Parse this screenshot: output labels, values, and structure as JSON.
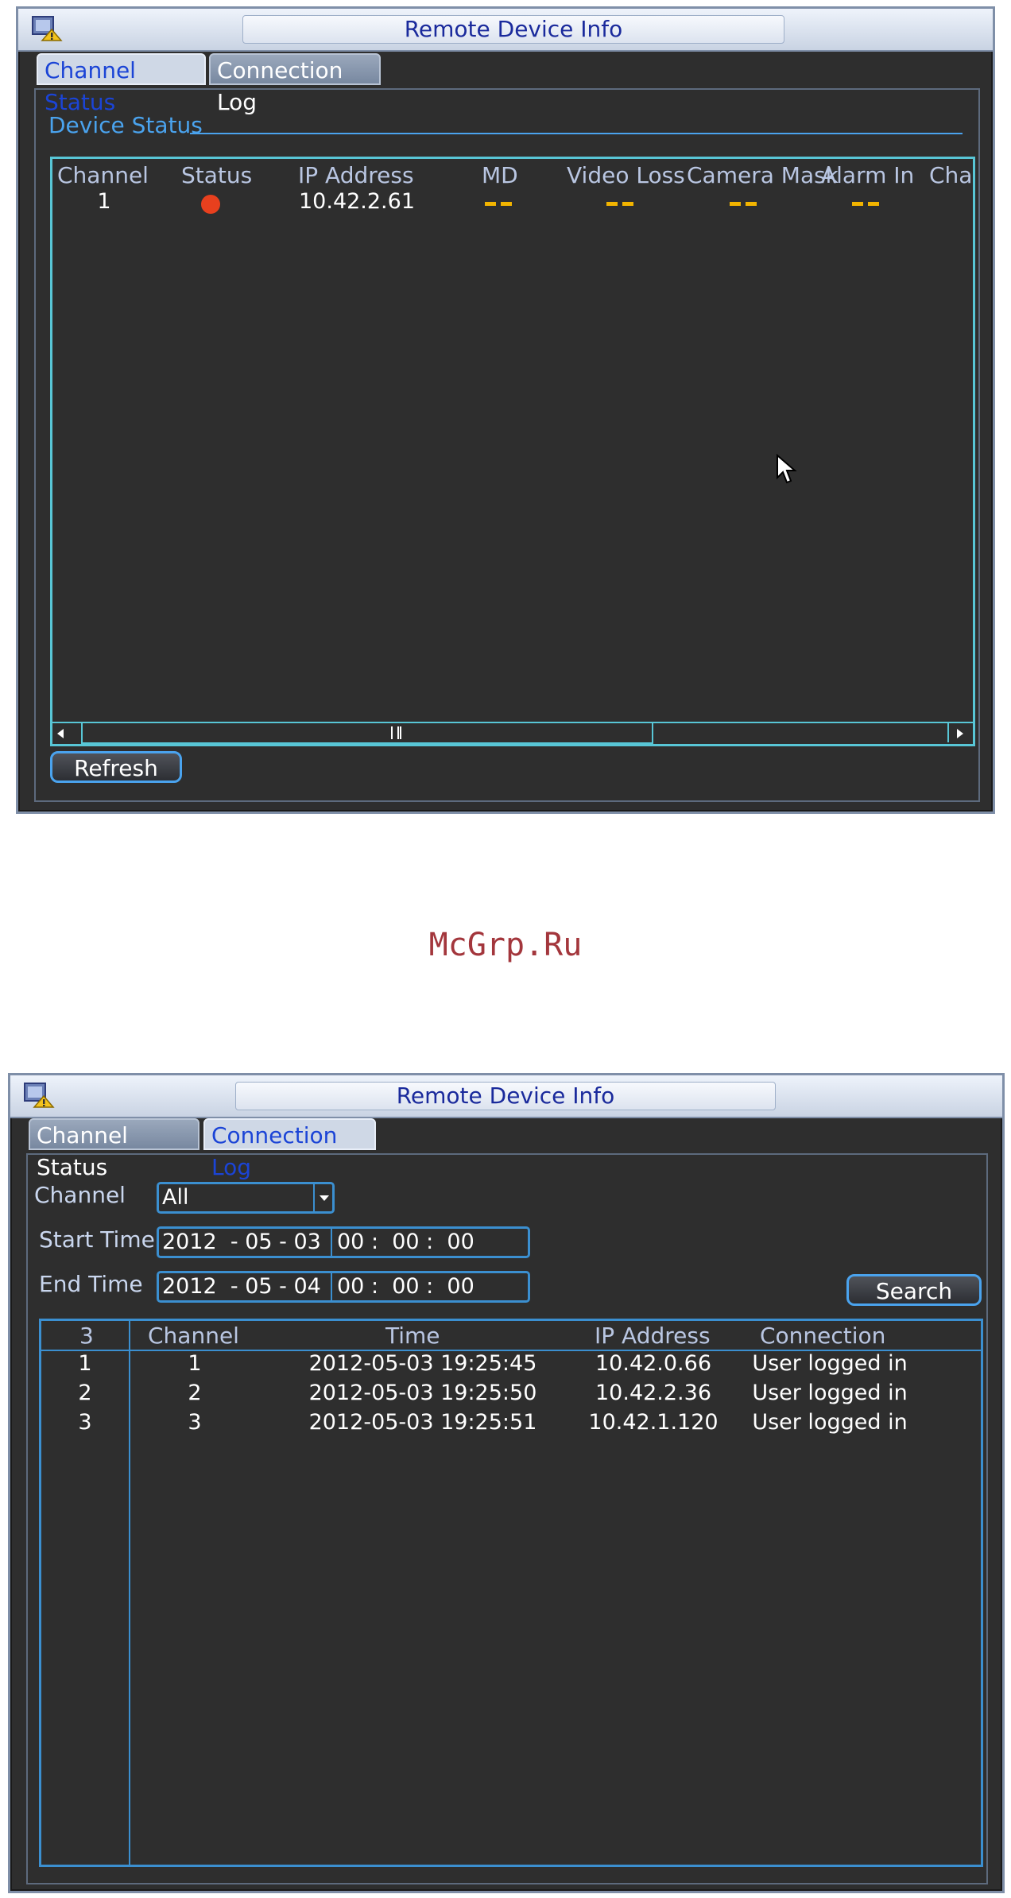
{
  "top_window": {
    "title": "Remote Device Info",
    "tabs": [
      {
        "label": "Channel Status",
        "active": true
      },
      {
        "label": "Connection Log",
        "active": false
      }
    ],
    "section_label": "Device Status",
    "columns": [
      "Channel",
      "Status",
      "IP Address",
      "MD",
      "Video Loss",
      "Camera Mask",
      "Alarm In",
      "Cha"
    ],
    "rows": [
      {
        "channel": "1",
        "status": "offline",
        "ip": "10.42.2.61",
        "md": "--",
        "video_loss": "--",
        "camera_mask": "--",
        "alarm_in": "--"
      }
    ],
    "refresh_label": "Refresh"
  },
  "watermark": "McGrp.Ru",
  "bottom_window": {
    "title": "Remote Device Info",
    "tabs": [
      {
        "label": "Channel Status",
        "active": false
      },
      {
        "label": "Connection Log",
        "active": true
      }
    ],
    "channel_label": "Channel",
    "channel_value": "All",
    "start_label": "Start Time",
    "start_date": "2012  - 05 - 03",
    "start_time": "00 :  00 :  00",
    "end_label": "End Time",
    "end_date": "2012  - 05 - 04",
    "end_time": "00 :  00 :  00",
    "search_label": "Search",
    "count": "3",
    "columns": [
      "Channel",
      "Time",
      "IP Address",
      "Connection"
    ],
    "rows": [
      {
        "index": "1",
        "channel": "1",
        "time": "2012-05-03 19:25:45",
        "ip": "10.42.0.66",
        "connection": "User logged in"
      },
      {
        "index": "2",
        "channel": "2",
        "time": "2012-05-03 19:25:50",
        "ip": "10.42.2.36",
        "connection": "User logged in"
      },
      {
        "index": "3",
        "channel": "3",
        "time": "2012-05-03 19:25:51",
        "ip": "10.42.1.120",
        "connection": "User logged in"
      }
    ]
  },
  "colors": {
    "panel_bg": "#2e2e2e",
    "accent_blue": "#4aa3ee",
    "grid_cyan": "#58c6d6",
    "status_red": "#e8401e",
    "dash_yellow": "#f2b400"
  }
}
